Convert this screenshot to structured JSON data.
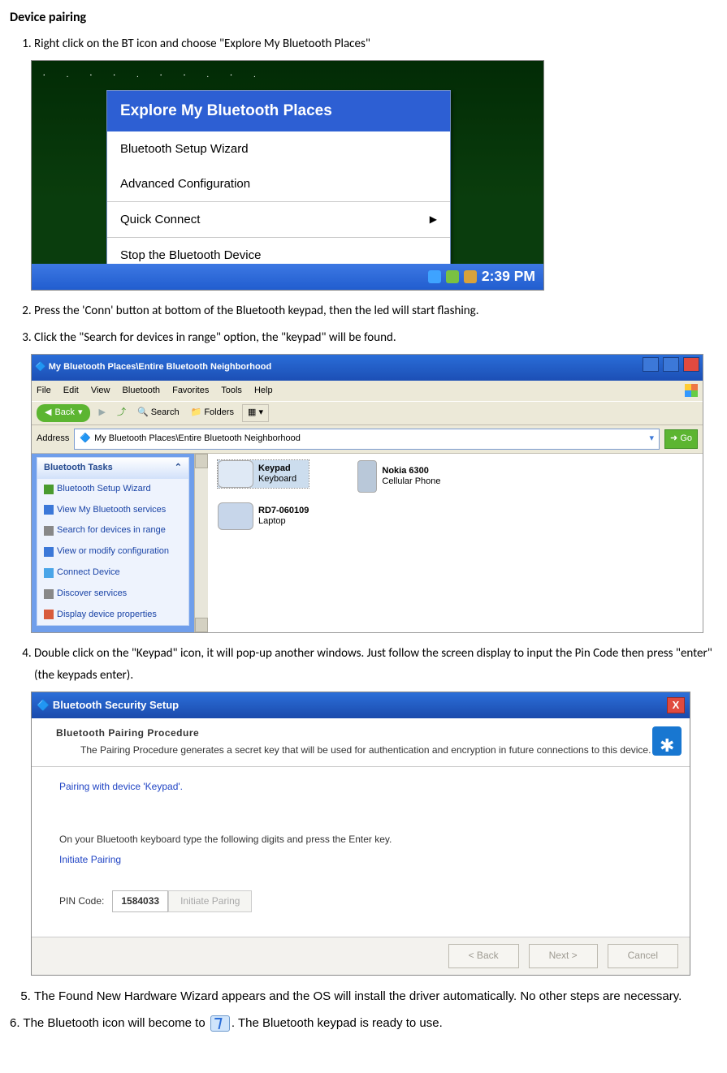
{
  "heading": "Device pairing",
  "steps": {
    "s1": "Right click on the BT icon and choose \"Explore My Bluetooth Places\"",
    "s2": "Press the 'Conn' button at bottom of the Bluetooth keypad, then the led will start flashing.",
    "s3": "Click the \"Search for devices in range\" option, the \"keypad\" will be found.",
    "s4": "Double click on the \"Keypad\" icon, it will pop-up another windows. Just follow the screen display to input the Pin Code then press \"enter\" (the keypads enter).",
    "s5": "The Found New Hardware Wizard appears and the OS will install the driver automatically. No other steps are necessary.",
    "s6_a": "6. The Bluetooth icon will become to ",
    "s6_b": ". The Bluetooth keypad is ready to use."
  },
  "shot1": {
    "menu": {
      "explore": "Explore My Bluetooth Places",
      "wizard": "Bluetooth Setup Wizard",
      "adv": "Advanced Configuration",
      "quick": "Quick Connect",
      "stop": "Stop the Bluetooth Device"
    },
    "clock": "2:39 PM"
  },
  "shot2": {
    "title": "My Bluetooth Places\\Entire Bluetooth Neighborhood",
    "menus": {
      "file": "File",
      "edit": "Edit",
      "view": "View",
      "bluetooth": "Bluetooth",
      "favorites": "Favorites",
      "tools": "Tools",
      "help": "Help"
    },
    "toolbar": {
      "back": "Back",
      "search": "Search",
      "folders": "Folders"
    },
    "address_label": "Address",
    "address_value": "My Bluetooth Places\\Entire Bluetooth Neighborhood",
    "go": "Go",
    "side_panel_title": "Bluetooth Tasks",
    "tasks": {
      "t1": "Bluetooth Setup Wizard",
      "t2": "View My Bluetooth services",
      "t3": "Search for devices in range",
      "t4": "View or modify configuration",
      "t5": "Connect Device",
      "t6": "Discover services",
      "t7": "Display device properties"
    },
    "devices": {
      "keypad_name": "Keypad",
      "keypad_type": "Keyboard",
      "laptop_name": "RD7-060109",
      "laptop_type": "Laptop",
      "phone_name": "Nokia 6300",
      "phone_type": "Cellular Phone"
    }
  },
  "shot3": {
    "title": "Bluetooth Security Setup",
    "hdr_title": "Bluetooth Pairing Procedure",
    "hdr_desc": "The Pairing Procedure generates a secret key that will be used for authentication and encryption in future connections to this device.",
    "pairing_with": "Pairing with device 'Keypad'.",
    "instruct": "On your Bluetooth keyboard type the following digits and press the Enter key.",
    "initiate_label": "Initiate Pairing",
    "pin_label": "PIN Code:",
    "pin_value": "1584033",
    "btn_initiate": "Initiate Paring",
    "btn_back": "< Back",
    "btn_next": "Next >",
    "btn_cancel": "Cancel"
  }
}
